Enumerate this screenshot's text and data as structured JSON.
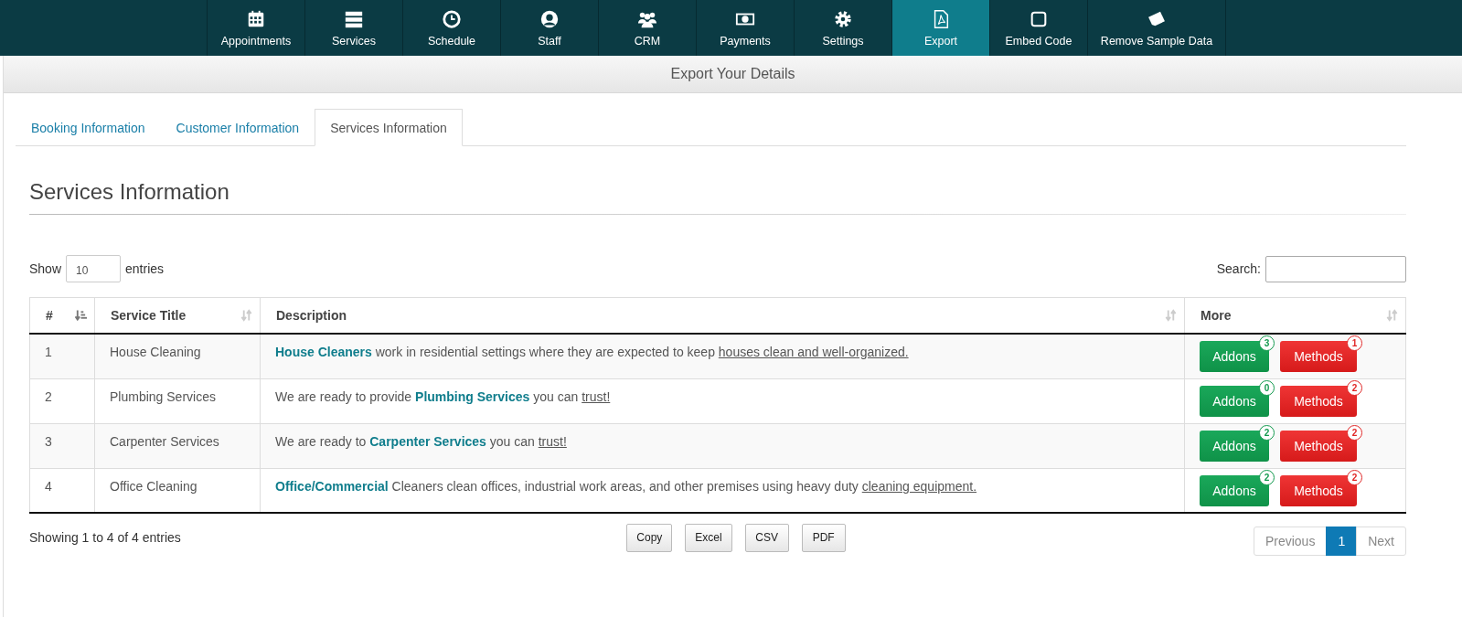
{
  "nav": [
    {
      "label": "Appointments",
      "selected": false
    },
    {
      "label": "Services",
      "selected": false
    },
    {
      "label": "Schedule",
      "selected": false
    },
    {
      "label": "Staff",
      "selected": false
    },
    {
      "label": "CRM",
      "selected": false
    },
    {
      "label": "Payments",
      "selected": false
    },
    {
      "label": "Settings",
      "selected": false
    },
    {
      "label": "Export",
      "selected": true
    },
    {
      "label": "Embed Code",
      "selected": false
    },
    {
      "label": "Remove Sample Data",
      "selected": false
    }
  ],
  "page_title": "Export Your Details",
  "tabs": [
    {
      "label": "Booking Information",
      "selected": false
    },
    {
      "label": "Customer Information",
      "selected": false
    },
    {
      "label": "Services Information",
      "selected": true
    }
  ],
  "section_title": "Services Information",
  "length": {
    "before": "Show",
    "value": "10",
    "after": "entries"
  },
  "search": {
    "label": "Search:"
  },
  "table": {
    "columns": [
      {
        "label": "#",
        "sorted": true
      },
      {
        "label": "Service Title",
        "sorted": false
      },
      {
        "label": "Description",
        "sorted": false
      },
      {
        "label": "More",
        "sorted": false
      }
    ],
    "rows": [
      {
        "num": "1",
        "title": "House Cleaning",
        "description": [
          {
            "kind": "bold",
            "text": "House Cleaners"
          },
          {
            "kind": "plain",
            "text": " work in residential settings where they are expected to keep "
          },
          {
            "kind": "link",
            "text": "houses clean and well-organized."
          }
        ],
        "addons": {
          "label": "Addons",
          "count": "3"
        },
        "methods": {
          "label": "Methods",
          "count": "1"
        }
      },
      {
        "num": "2",
        "title": "Plumbing Services",
        "description": [
          {
            "kind": "plain",
            "text": "We are ready to provide "
          },
          {
            "kind": "bold",
            "text": "Plumbing Services"
          },
          {
            "kind": "plain",
            "text": " you can "
          },
          {
            "kind": "link",
            "text": "trust!"
          }
        ],
        "addons": {
          "label": "Addons",
          "count": "0"
        },
        "methods": {
          "label": "Methods",
          "count": "2"
        }
      },
      {
        "num": "3",
        "title": "Carpenter Services",
        "description": [
          {
            "kind": "plain",
            "text": "We are ready to "
          },
          {
            "kind": "bold",
            "text": "Carpenter Services"
          },
          {
            "kind": "plain",
            "text": " you can "
          },
          {
            "kind": "link",
            "text": "trust!"
          }
        ],
        "addons": {
          "label": "Addons",
          "count": "2"
        },
        "methods": {
          "label": "Methods",
          "count": "2"
        }
      },
      {
        "num": "4",
        "title": "Office Cleaning",
        "description": [
          {
            "kind": "bold",
            "text": "Office/Commercial"
          },
          {
            "kind": "plain",
            "text": " Cleaners clean offices, industrial work areas, and other premises using heavy duty "
          },
          {
            "kind": "link",
            "text": "cleaning equipment."
          }
        ],
        "addons": {
          "label": "Addons",
          "count": "2"
        },
        "methods": {
          "label": "Methods",
          "count": "2"
        }
      }
    ]
  },
  "info": "Showing 1 to 4 of 4 entries",
  "export_buttons": [
    "Copy",
    "Excel",
    "CSV",
    "PDF"
  ],
  "pagination": [
    {
      "label": "Previous",
      "selected": false
    },
    {
      "label": "1",
      "selected": true
    },
    {
      "label": "Next",
      "selected": false
    }
  ]
}
